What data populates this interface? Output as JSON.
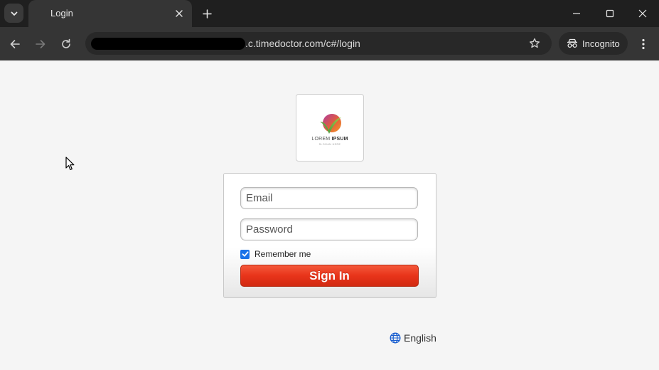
{
  "browser": {
    "tab": {
      "title": "Login"
    },
    "url": ".c.timedoctor.com/c#/login",
    "incognito_label": "Incognito"
  },
  "logo": {
    "brand_light": "LOREM",
    "brand_bold": "IPSUM",
    "tagline": "SLOGAN HERE"
  },
  "login_form": {
    "email_placeholder": "Email",
    "password_placeholder": "Password",
    "remember_label": "Remember me",
    "remember_checked": true,
    "sign_in_label": "Sign In"
  },
  "language": {
    "current": "English"
  },
  "colors": {
    "accent": "#1a73e8",
    "sign_in_button": "#e8341a",
    "chrome_dark": "#1f1f1f",
    "chrome_toolbar": "#353535"
  },
  "icons": {
    "tab_search": "chevron-down-icon",
    "tab_close": "close-icon",
    "new_tab": "plus-icon",
    "back": "arrow-left-icon",
    "forward": "arrow-right-icon",
    "reload": "reload-icon",
    "bookmark": "star-icon",
    "incognito": "incognito-icon",
    "menu": "kebab-menu-icon",
    "language": "globe-icon"
  }
}
